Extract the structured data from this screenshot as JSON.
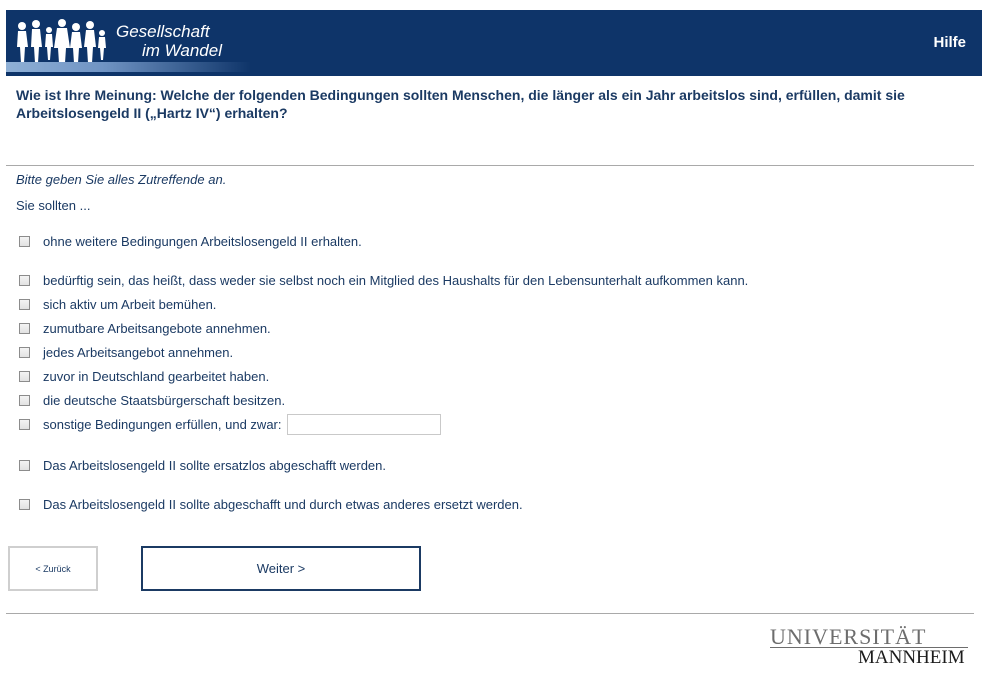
{
  "header": {
    "logo_line1": "Gesellschaft",
    "logo_line2": "im Wandel",
    "help_label": "Hilfe"
  },
  "question": {
    "text": "Wie ist Ihre Meinung: Welche der folgenden Bedingungen sollten Menschen, die länger als ein Jahr arbeitslos sind, erfüllen, damit sie Arbeitslosengeld II („Hartz IV“) erhalten?",
    "instruction": "Bitte geben Sie alles Zutreffende an.",
    "prompt": "Sie sollten ..."
  },
  "options": [
    {
      "label": "ohne weitere Bedingungen Arbeitslosengeld II erhalten.",
      "checked": false
    },
    {
      "label": "bedürftig sein, das heißt, dass weder sie selbst noch ein Mitglied des Haushalts für den Lebensunterhalt aufkommen kann.",
      "checked": false
    },
    {
      "label": "sich aktiv um Arbeit bemühen.",
      "checked": false
    },
    {
      "label": "zumutbare Arbeitsangebote annehmen.",
      "checked": false
    },
    {
      "label": "jedes Arbeitsangebot annehmen.",
      "checked": false
    },
    {
      "label": "zuvor in Deutschland gearbeitet haben.",
      "checked": false
    },
    {
      "label": "die deutsche Staatsbürgerschaft besitzen.",
      "checked": false
    },
    {
      "label": "sonstige Bedingungen erfüllen, und zwar:",
      "checked": false,
      "text_value": ""
    },
    {
      "label": "Das Arbeitslosengeld II sollte ersatzlos abgeschafft werden.",
      "checked": false
    },
    {
      "label": "Das Arbeitslosengeld II sollte abgeschafft und durch etwas anderes ersetzt werden.",
      "checked": false
    }
  ],
  "nav": {
    "back_label": "< Zurück",
    "next_label": "Weiter >"
  },
  "footer": {
    "uni_line1": "UNIVERSITÄT",
    "uni_line2": "MANNHEIM"
  },
  "colors": {
    "header_bg": "#0e3469",
    "text": "#1b3a63"
  }
}
